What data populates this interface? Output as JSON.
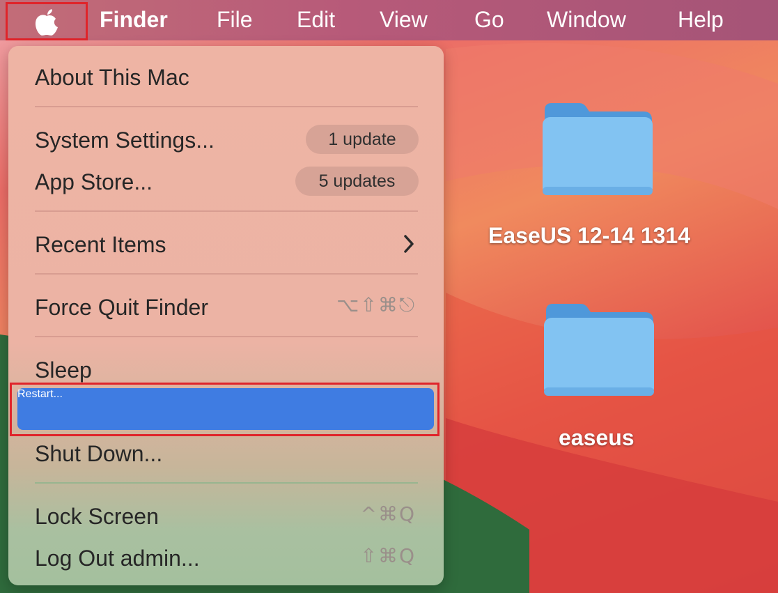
{
  "menubar": {
    "apple_icon": "apple-logo-icon",
    "app_name": "Finder",
    "items": [
      "File",
      "Edit",
      "View",
      "Go",
      "Window",
      "Help"
    ]
  },
  "apple_menu": {
    "about": "About This Mac",
    "system_settings": {
      "label": "System Settings...",
      "badge": "1 update"
    },
    "app_store": {
      "label": "App Store...",
      "badge": "5 updates"
    },
    "recent_items": {
      "label": "Recent Items",
      "icon": "chevron-right-icon"
    },
    "force_quit": {
      "label": "Force Quit Finder",
      "shortcut": "⌥⇧⌘⎋"
    },
    "sleep": "Sleep",
    "restart": "Restart...",
    "shut_down": "Shut Down...",
    "lock_screen": {
      "label": "Lock Screen",
      "shortcut": "^⌘Q"
    },
    "log_out": {
      "label": "Log Out admin...",
      "shortcut": "⇧⌘Q"
    },
    "highlighted_item": "Restart...",
    "highlight_color": "#3f7ce2"
  },
  "desktop": {
    "icons": [
      {
        "label": "EaseUS 12-14 1314",
        "icon": "folder-icon"
      },
      {
        "label": "easeus",
        "icon": "folder-icon"
      }
    ]
  },
  "annotation_color": "#e0242a"
}
